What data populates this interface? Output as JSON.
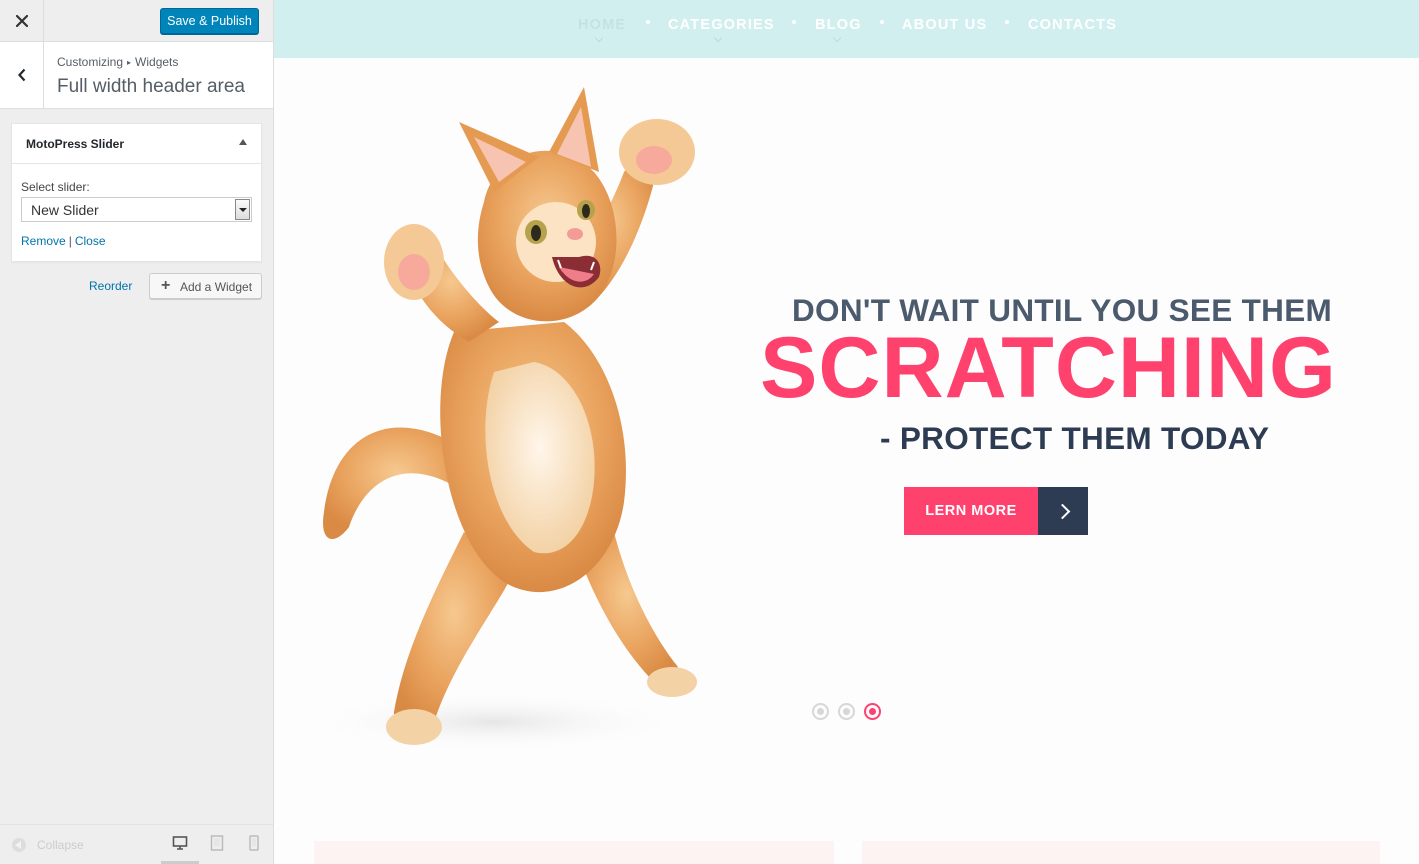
{
  "sidebar": {
    "publish_label": "Save & Publish",
    "breadcrumb": {
      "root": "Customizing",
      "separator": "▸",
      "current": "Widgets"
    },
    "section_title": "Full width header area",
    "widget": {
      "title": "MotoPress Slider",
      "select_label": "Select slider:",
      "select_value": "New Slider",
      "remove_label": "Remove",
      "separator": "|",
      "close_label": "Close"
    },
    "reorder_label": "Reorder",
    "add_widget_label": "Add a Widget",
    "collapse_label": "Collapse"
  },
  "preview": {
    "nav": [
      {
        "label": "HOME",
        "active": true
      },
      {
        "label": "CATEGORIES",
        "active": false
      },
      {
        "label": "BLOG",
        "active": false
      },
      {
        "label": "ABOUT US",
        "active": false
      },
      {
        "label": "CONTACTS",
        "active": false
      }
    ],
    "slide": {
      "line1": "DON'T WAIT UNTIL YOU SEE THEM",
      "line2": "SCRATCHING",
      "line3": "- PROTECT THEM TODAY",
      "cta_label": "LERN MORE"
    },
    "slider": {
      "count": 3,
      "active_index": 2
    }
  },
  "colors": {
    "accent": "#ff416e",
    "dark": "#2d3c53",
    "nav_bg": "#d2eff0",
    "wp_blue": "#0085ba"
  },
  "icons": {
    "close": "close-icon",
    "back": "chevron-left-icon",
    "plus": "plus-icon",
    "collapse": "collapse-arrow-icon",
    "desktop": "desktop-icon",
    "tablet": "tablet-icon",
    "mobile": "mobile-icon"
  }
}
